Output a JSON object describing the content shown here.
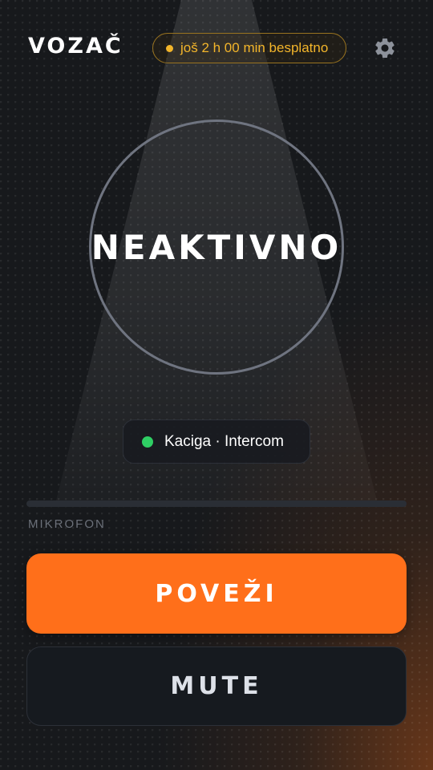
{
  "header": {
    "title": "VOZAČ",
    "trial_badge": "još 2 h 00 min besplatno",
    "settings_icon": "gear-icon"
  },
  "status": {
    "label": "NEAKTIVNO"
  },
  "device": {
    "label": "Kaciga · Intercom",
    "status_color": "#2fcf64"
  },
  "microphone": {
    "label": "MIKROFON",
    "level": 0
  },
  "actions": {
    "connect_label": "POVEŽI",
    "mute_label": "MUTE"
  },
  "colors": {
    "accent": "#ff6f1a",
    "badge": "#f3b52a",
    "background": "#17191c"
  }
}
